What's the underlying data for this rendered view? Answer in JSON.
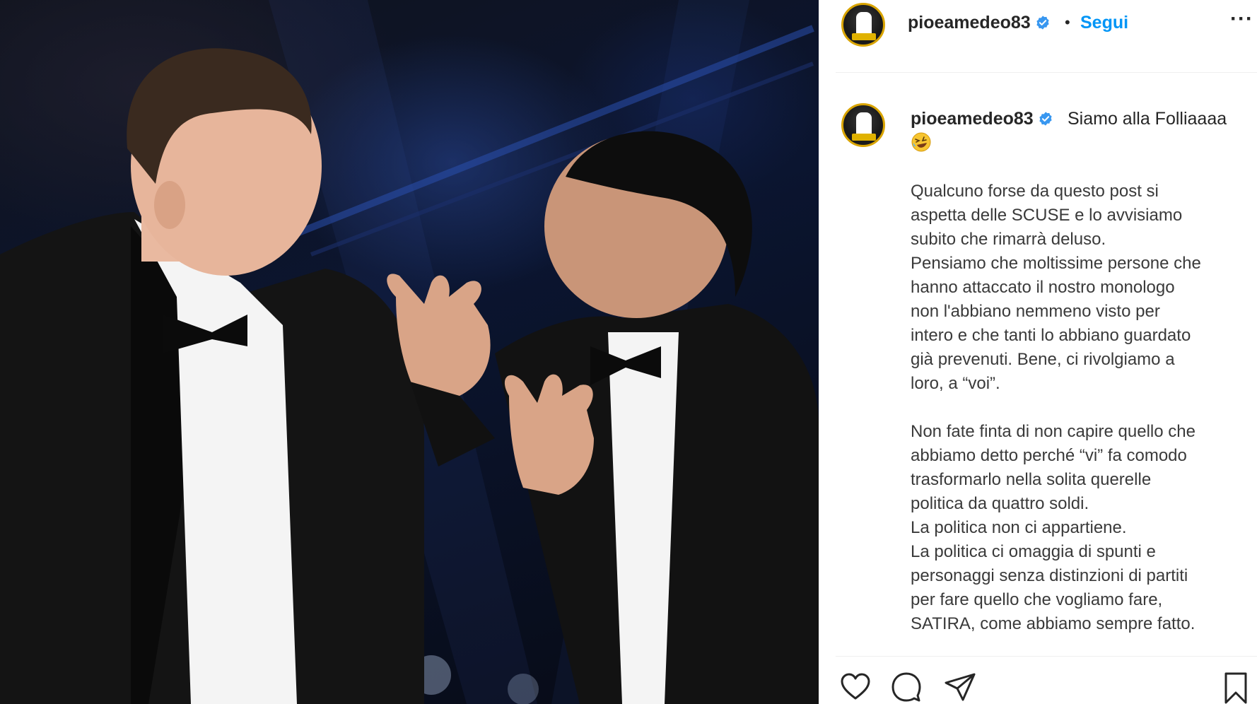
{
  "post": {
    "username": "pioeamedeo83",
    "follow_label": "Segui",
    "separator": "•",
    "more_label": "···",
    "caption_headline": "Siamo alla Folliaaaa",
    "caption_body": "Qualcuno forse da questo post si\naspetta delle SCUSE e lo avvisiamo\nsubito che rimarrà deluso.\nPensiamo che moltissime persone che\nhanno attaccato il nostro monologo\nnon l'abbiano nemmeno visto per\nintero e che tanti lo abbiano guardato\ngià prevenuti. Bene, ci rivolgiamo a\nloro, a “voi”.\n\nNon fate finta di non capire quello che\nabbiamo detto perché “vi” fa comodo\ntrasformarlo nella solita querelle\npolitica da quattro soldi.\nLa politica non ci appartiene.\nLa politica ci omaggia di spunti e\npersonaggi senza distinzioni di partiti\nper fare quello che vogliamo fare,\nSATIRA, come abbiamo sempre fatto."
  },
  "icons": {
    "verified": "verified-badge-icon",
    "emoji": "rolling-laughing-emoji",
    "like": "heart-icon",
    "comment": "comment-bubble-icon",
    "share": "paper-plane-icon",
    "save": "bookmark-icon"
  },
  "colors": {
    "link_blue": "#0095f6",
    "verified_blue": "#3897f0",
    "text": "#262626"
  }
}
